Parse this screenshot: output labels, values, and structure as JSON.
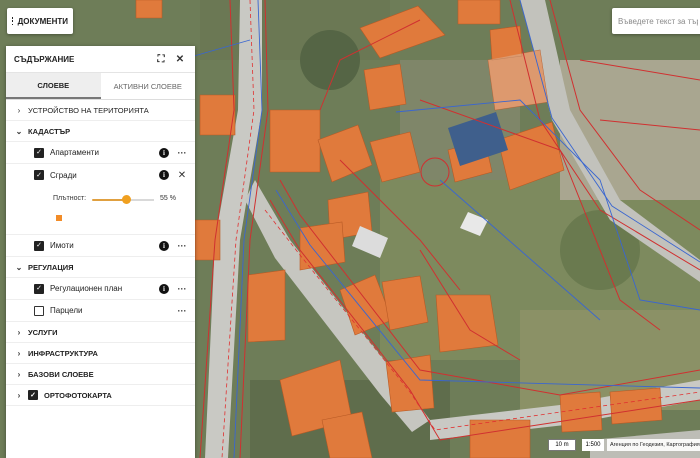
{
  "toolbar": {
    "documents_label": "ДОКУМЕНТИ"
  },
  "search": {
    "placeholder": "Въведете текст за търсене"
  },
  "panel": {
    "title": "СЪДЪРЖАНИЕ",
    "tabs": [
      {
        "label": "СЛОЕВЕ",
        "active": true
      },
      {
        "label": "АКТИВНИ СЛОЕВЕ",
        "active": false
      }
    ],
    "groups": {
      "spatial": {
        "label": "УСТРОЙСТВО НА ТЕРИТОРИЯТА",
        "expanded": false
      },
      "cadastre": {
        "label": "КАДАСТЪР",
        "expanded": true,
        "layers": [
          {
            "label": "Апартаменти",
            "checked": true
          },
          {
            "label": "Сгради",
            "checked": true
          },
          {
            "label": "Имоти",
            "checked": true
          }
        ],
        "opacity": {
          "label": "Плътност:",
          "value": "55 %",
          "fraction": 0.55
        }
      },
      "regulation": {
        "label": "РЕГУЛАЦИЯ",
        "expanded": true,
        "layers": [
          {
            "label": "Регулационен план",
            "checked": true
          },
          {
            "label": "Парцели",
            "checked": false
          }
        ]
      },
      "services": {
        "label": "УСЛУГИ"
      },
      "infrastructure": {
        "label": "ИНФРАСТРУКТУРА"
      },
      "base": {
        "label": "БАЗОВИ СЛОЕВЕ"
      },
      "ortho": {
        "label": "ОРТОФОТОКАРТА",
        "checked": true
      }
    }
  },
  "map": {
    "scale_bar": "10 m",
    "scale_ratio": "1:500",
    "attribution": "Агенция по Геодезия, Картография и Кадастър"
  },
  "icons": {
    "menu": "hamburger-icon",
    "fullscreen": "fullscreen-icon",
    "close": "close-icon",
    "chevron_right": "chevron-right-icon",
    "chevron_down": "chevron-down-icon",
    "info": "info-icon",
    "more": "more-icon"
  },
  "colors": {
    "roof": "#e07a3c",
    "road": "#c9c9c4",
    "cadastre_line": "#d03030",
    "regulation_line": "#3a66d0",
    "slider_accent": "#f0a020"
  }
}
